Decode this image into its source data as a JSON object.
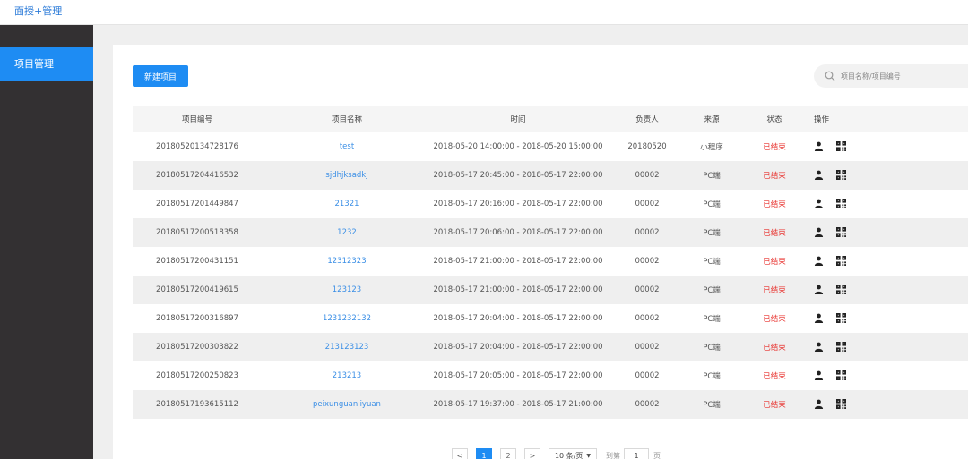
{
  "header": {
    "brand": "面授+管理"
  },
  "sidebar": {
    "items": [
      {
        "label": "项目管理"
      }
    ]
  },
  "toolbar": {
    "new_project_label": "新建项目"
  },
  "search": {
    "placeholder": "项目名称/项目编号",
    "value": "",
    "icon": "search-icon"
  },
  "table": {
    "columns": [
      "项目编号",
      "项目名称",
      "时间",
      "负责人",
      "来源",
      "状态",
      "操作"
    ],
    "rows": [
      {
        "id": "20180520134728176",
        "name": "test",
        "time": "2018-05-20 14:00:00 - 2018-05-20 15:00:00",
        "owner": "20180520",
        "source": "小程序",
        "status": "已结束"
      },
      {
        "id": "20180517204416532",
        "name": "sjdhjksadkj",
        "time": "2018-05-17 20:45:00 - 2018-05-17 22:00:00",
        "owner": "00002",
        "source": "PC端",
        "status": "已结束"
      },
      {
        "id": "20180517201449847",
        "name": "21321",
        "time": "2018-05-17 20:16:00 - 2018-05-17 22:00:00",
        "owner": "00002",
        "source": "PC端",
        "status": "已结束"
      },
      {
        "id": "20180517200518358",
        "name": "1232",
        "time": "2018-05-17 20:06:00 - 2018-05-17 22:00:00",
        "owner": "00002",
        "source": "PC端",
        "status": "已结束"
      },
      {
        "id": "20180517200431151",
        "name": "12312323",
        "time": "2018-05-17 21:00:00 - 2018-05-17 22:00:00",
        "owner": "00002",
        "source": "PC端",
        "status": "已结束"
      },
      {
        "id": "20180517200419615",
        "name": "123123",
        "time": "2018-05-17 21:00:00 - 2018-05-17 22:00:00",
        "owner": "00002",
        "source": "PC端",
        "status": "已结束"
      },
      {
        "id": "20180517200316897",
        "name": "1231232132",
        "time": "2018-05-17 20:04:00 - 2018-05-17 22:00:00",
        "owner": "00002",
        "source": "PC端",
        "status": "已结束"
      },
      {
        "id": "20180517200303822",
        "name": "213123123",
        "time": "2018-05-17 20:04:00 - 2018-05-17 22:00:00",
        "owner": "00002",
        "source": "PC端",
        "status": "已结束"
      },
      {
        "id": "20180517200250823",
        "name": "213213",
        "time": "2018-05-17 20:05:00 - 2018-05-17 22:00:00",
        "owner": "00002",
        "source": "PC端",
        "status": "已结束"
      },
      {
        "id": "20180517193615112",
        "name": "peixunguanliyuan",
        "time": "2018-05-17 19:37:00 - 2018-05-17 21:00:00",
        "owner": "00002",
        "source": "PC端",
        "status": "已结束"
      }
    ],
    "row_icons": [
      "user-icon",
      "qrcode-icon"
    ]
  },
  "pagination": {
    "prev": "<",
    "pages": [
      "1",
      "2"
    ],
    "current_page": "1",
    "next": ">",
    "page_size": "10 条/页",
    "goto_label": "到第",
    "goto_value": "1",
    "page_suffix": "页"
  },
  "colors": {
    "accent": "#1e8cf3",
    "sidebar_bg": "#333032",
    "status_ended": "#e8302c",
    "link": "#3b8fe6"
  }
}
